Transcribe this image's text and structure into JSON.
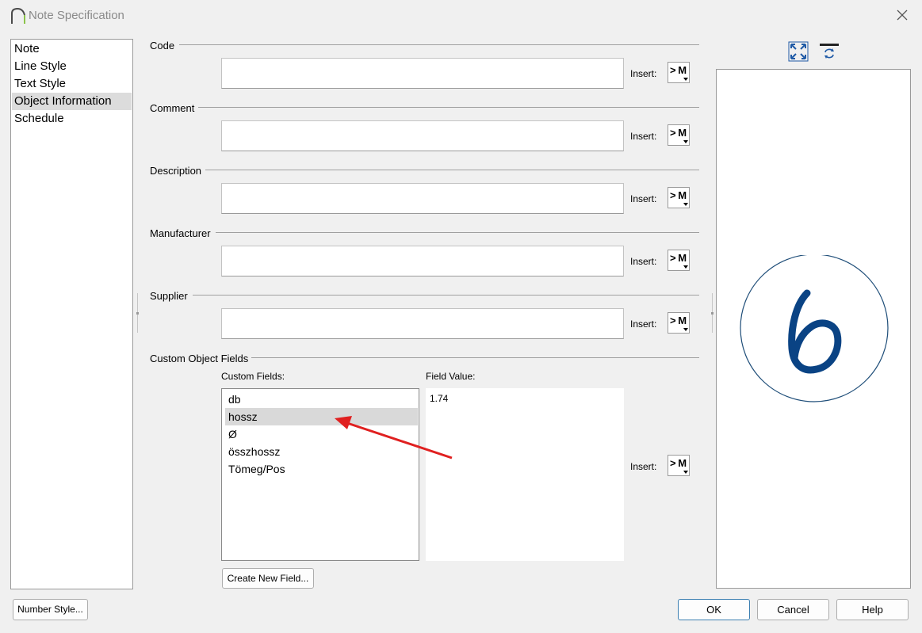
{
  "window": {
    "title": "Note Specification"
  },
  "nav": {
    "items": [
      "Note",
      "Line Style",
      "Text Style",
      "Object Information",
      "Schedule"
    ],
    "selected": "Object Information"
  },
  "sections": {
    "code": {
      "label": "Code",
      "value": ""
    },
    "comment": {
      "label": "Comment",
      "value": ""
    },
    "description": {
      "label": "Description",
      "value": ""
    },
    "manufacturer": {
      "label": "Manufacturer",
      "value": ""
    },
    "supplier": {
      "label": "Supplier",
      "value": ""
    }
  },
  "insert": {
    "label": "Insert:",
    "button_text": "> M"
  },
  "custom": {
    "section_label": "Custom Object Fields",
    "fields_label": "Custom Fields:",
    "value_label": "Field Value:",
    "fields": [
      "db",
      "hossz",
      "Ø",
      "összhossz",
      "Tömeg/Pos"
    ],
    "selected": "hossz",
    "field_value": "1.74",
    "create_button": "Create New Field..."
  },
  "buttons": {
    "number_style": "Number Style...",
    "ok": "OK",
    "cancel": "Cancel",
    "help": "Help"
  },
  "preview": {
    "label_text": "6"
  },
  "colors": {
    "accent": "#0050a0",
    "annotation_arrow": "#e02020",
    "preview_stroke": "#0a4384",
    "preview_circle": "#1f4e79"
  },
  "icons": [
    "app-icon",
    "close-icon",
    "fill-window-icon",
    "refresh-preview-icon",
    "dropdown-arrow-icon"
  ]
}
